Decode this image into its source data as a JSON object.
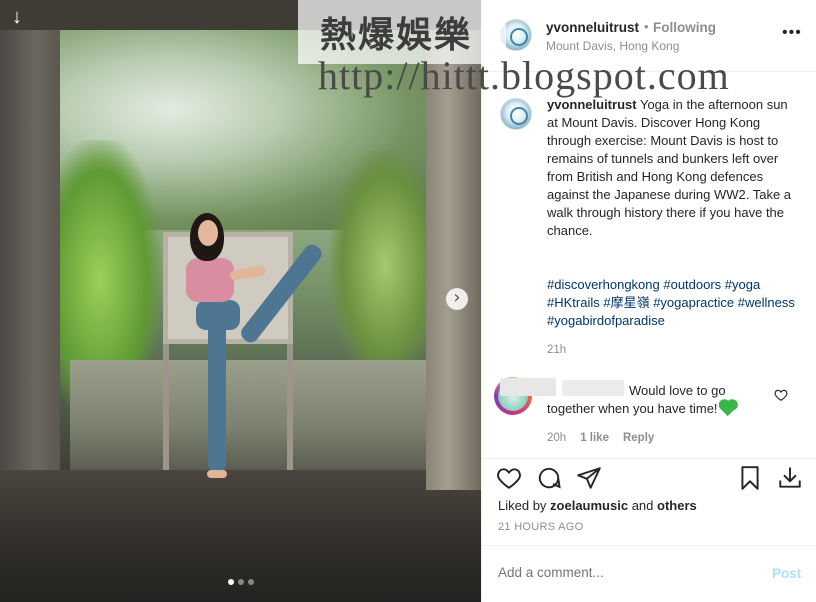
{
  "watermark": {
    "chinese": "熱爆娛樂",
    "url": "http://hittt.blogspot.com"
  },
  "post": {
    "username": "yvonneluitrust",
    "separator": "•",
    "follow_status": "Following",
    "location": "Mount Davis, Hong Kong",
    "more_icon": "more-horizontal-icon",
    "caption": "Yoga in the afternoon sun at Mount Davis. Discover Hong Kong through exercise: Mount Davis is host to remains of tunnels and bunkers left over from British and Hong Kong defences against the Japanese during WW2. Take a walk through history there if you have the chance.",
    "hashtags": "#discoverhongkong #outdoors #yoga #HKtrails #摩星嶺 #yogapractice #wellness #yogabirdofparadise",
    "caption_time": "21h"
  },
  "comment": {
    "text": "Would love to go together when you have time!",
    "emoji": "green-heart",
    "time": "20h",
    "likes": "1 like",
    "reply": "Reply"
  },
  "actions": {
    "like_icon": "heart-icon",
    "comment_icon": "comment-icon",
    "share_icon": "paper-plane-icon",
    "save_icon": "bookmark-icon",
    "download_icon": "download-icon"
  },
  "likes": {
    "prefix": "Liked by",
    "user": "zoelaumusic",
    "and": "and",
    "others": "others"
  },
  "timestamp": "21 HOURS AGO",
  "add_comment": {
    "placeholder": "Add a comment...",
    "post_label": "Post"
  },
  "carousel": {
    "slides": 3,
    "active": 1
  },
  "colors": {
    "link": "#00376b",
    "muted": "#8e8e8e",
    "post_disabled": "#b3dbff",
    "heart_green": "#39b54a"
  }
}
